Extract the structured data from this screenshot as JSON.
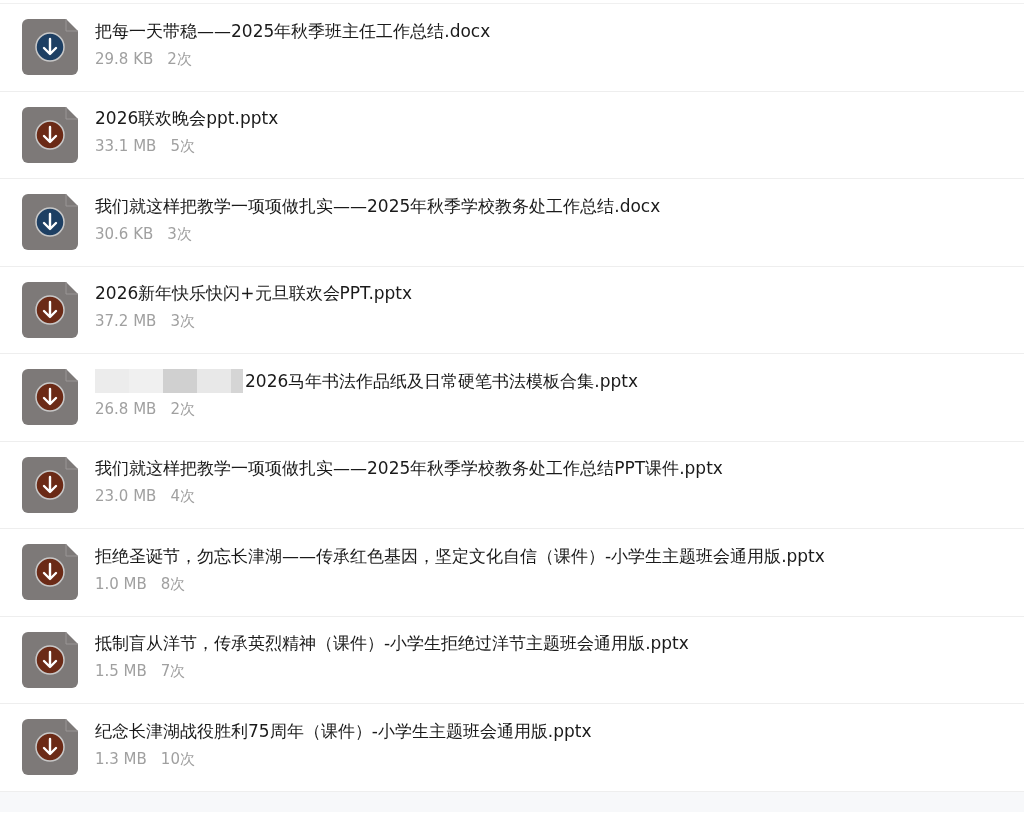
{
  "files": [
    {
      "kind": "docx",
      "redacted": false,
      "name": "把每一天带稳——2025年秋季班主任工作总结.docx",
      "size": "29.8 KB",
      "count": "2次"
    },
    {
      "kind": "pptx",
      "redacted": false,
      "name": "2026联欢晚会ppt.pptx",
      "size": "33.1 MB",
      "count": "5次"
    },
    {
      "kind": "docx",
      "redacted": false,
      "name": "我们就这样把教学一项项做扎实——2025年秋季学校教务处工作总结.docx",
      "size": "30.6 KB",
      "count": "3次"
    },
    {
      "kind": "pptx",
      "redacted": false,
      "name": "2026新年快乐快闪+元旦联欢会PPT.pptx",
      "size": "37.2 MB",
      "count": "3次"
    },
    {
      "kind": "pptx",
      "redacted": true,
      "name": "2026马年书法作品纸及日常硬笔书法模板合集.pptx",
      "size": "26.8 MB",
      "count": "2次"
    },
    {
      "kind": "pptx",
      "redacted": false,
      "name": "我们就这样把教学一项项做扎实——2025年秋季学校教务处工作总结PPT课件.pptx",
      "size": "23.0 MB",
      "count": "4次"
    },
    {
      "kind": "pptx",
      "redacted": false,
      "name": "拒绝圣诞节，勿忘长津湖——传承红色基因，坚定文化自信（课件）-小学生主题班会通用版.pptx",
      "size": "1.0 MB",
      "count": "8次"
    },
    {
      "kind": "pptx",
      "redacted": false,
      "name": "抵制盲从洋节，传承英烈精神（课件）-小学生拒绝过洋节主题班会通用版.pptx",
      "size": "1.5 MB",
      "count": "7次"
    },
    {
      "kind": "pptx",
      "redacted": false,
      "name": "纪念长津湖战役胜利75周年（课件）-小学生主题班会通用版.pptx",
      "size": "1.3 MB",
      "count": "10次"
    }
  ]
}
